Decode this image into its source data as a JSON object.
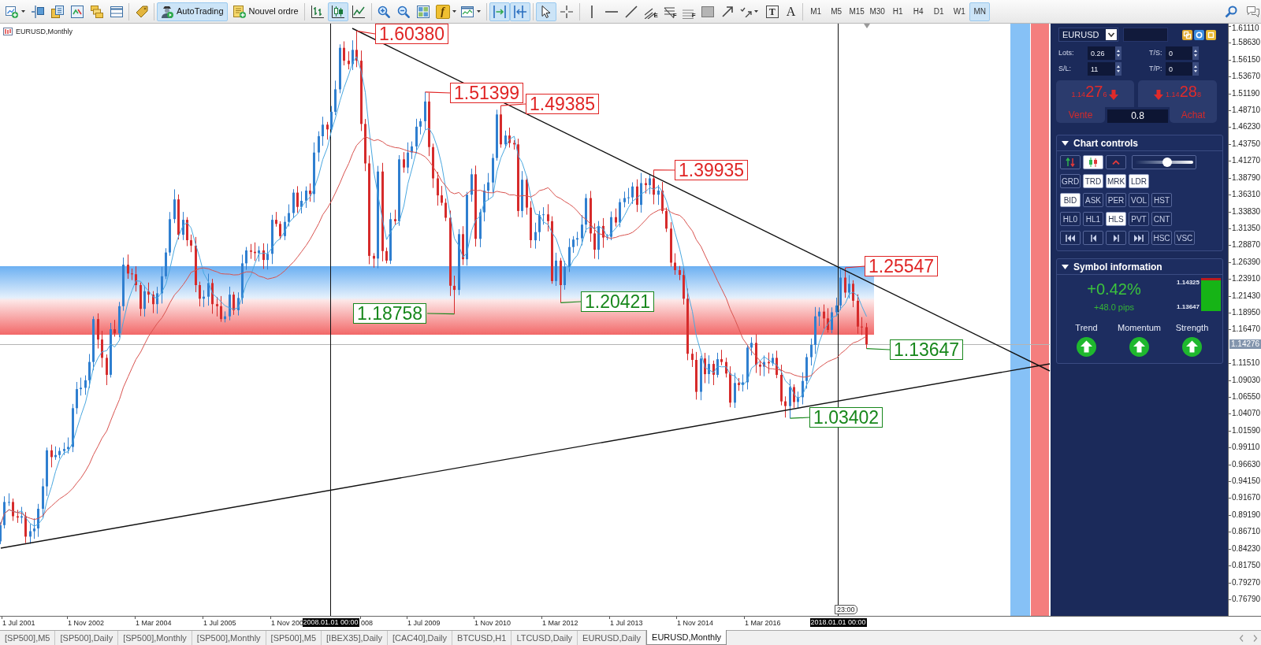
{
  "toolbar": {
    "auto_trading": {
      "label": "AutoTrading",
      "on": true
    },
    "new_order": {
      "label": "Nouvel ordre"
    },
    "chart_types": [
      {
        "selected": false
      },
      {
        "selected": true
      },
      {
        "selected": false
      }
    ],
    "indicators": {
      "label": "f"
    },
    "auto_scroll": {
      "on": true
    },
    "chart_shift": {
      "on": true
    },
    "cursor_modes": [
      {
        "selected": true
      },
      {
        "selected": false
      }
    ],
    "drawing_tools": [
      {
        "mark": "E"
      },
      {
        "mark": "F"
      },
      {
        "mark": "F"
      }
    ],
    "text_tools": [
      "T",
      "A"
    ],
    "timeframes": [
      {
        "label": "M1",
        "selected": false
      },
      {
        "label": "M5",
        "selected": false
      },
      {
        "label": "M15",
        "selected": false
      },
      {
        "label": "M30",
        "selected": false
      },
      {
        "label": "H1",
        "selected": false
      },
      {
        "label": "H4",
        "selected": false
      },
      {
        "label": "D1",
        "selected": false
      },
      {
        "label": "W1",
        "selected": false
      },
      {
        "label": "MN",
        "selected": true
      }
    ]
  },
  "chart": {
    "title": "EURUSD,Monthly",
    "price_labels": [
      {
        "text": "1.60380",
        "color": "#e02424"
      },
      {
        "text": "1.51399",
        "color": "#e02424"
      },
      {
        "text": "1.49385",
        "color": "#e02424"
      },
      {
        "text": "1.39935",
        "color": "#e02424"
      },
      {
        "text": "1.25547",
        "color": "#e02424"
      },
      {
        "text": "1.18758",
        "color": "#17871b"
      },
      {
        "text": "1.20421",
        "color": "#17871b"
      },
      {
        "text": "1.13647",
        "color": "#17871b"
      },
      {
        "text": "1.03402",
        "color": "#17871b"
      }
    ],
    "time_marker": "23:00"
  },
  "trade_panel": {
    "symbol": "EURUSD",
    "fields": [
      {
        "label": "Lots:",
        "value": "0.26"
      },
      {
        "label": "T/S:",
        "value": "0"
      },
      {
        "label": "S/L:",
        "value": "11"
      },
      {
        "label": "T/P:",
        "value": "0"
      }
    ],
    "sell": {
      "big_figure": "1.14",
      "pips": "27",
      "point": "6",
      "rising": false,
      "label": "Vente"
    },
    "buy": {
      "big_figure": "1.14",
      "pips": "28",
      "point": "8",
      "rising": false,
      "label": "Achat"
    },
    "spread": "0.8"
  },
  "chart_controls": {
    "title": "Chart controls",
    "expanded": true,
    "tool_buttons": [
      {
        "selected": false
      },
      {
        "selected": true
      },
      {
        "selected": false
      }
    ],
    "slider": {
      "level": 0.56
    },
    "toggle_rows": [
      [
        {
          "label": "GRD",
          "selected": false
        },
        {
          "label": "TRD",
          "selected": true
        },
        {
          "label": "MRK",
          "selected": true
        },
        {
          "label": "LDR",
          "selected": true
        }
      ],
      [
        {
          "label": "BID",
          "selected": true
        },
        {
          "label": "ASK",
          "selected": false
        },
        {
          "label": "PER",
          "selected": false
        },
        {
          "label": "VOL",
          "selected": false
        },
        {
          "label": "HST",
          "selected": false
        }
      ],
      [
        {
          "label": "HL0",
          "selected": false
        },
        {
          "label": "HL1",
          "selected": false
        },
        {
          "label": "HLS",
          "selected": true
        },
        {
          "label": "PVT",
          "selected": false
        },
        {
          "label": "CNT",
          "selected": false
        }
      ]
    ],
    "navigation": [
      {
        "kind": "icon",
        "selected": false
      },
      {
        "kind": "icon",
        "selected": false
      },
      {
        "kind": "icon",
        "selected": false
      },
      {
        "kind": "icon",
        "selected": false
      },
      {
        "kind": "text",
        "label": "HSC",
        "selected": false
      },
      {
        "kind": "text",
        "label": "VSC",
        "selected": false
      }
    ]
  },
  "symbol_information": {
    "title": "Symbol information",
    "expanded": true,
    "change_percent": "+0.42%",
    "change_pips": "+48.0 pips",
    "range_high": "1.14325",
    "range_low": "1.13647",
    "range_bar": {
      "level": 0.93
    },
    "signals": [
      {
        "label": "Trend",
        "rising": true
      },
      {
        "label": "Momentum",
        "rising": true
      },
      {
        "label": "Strength",
        "rising": true
      }
    ]
  },
  "price_axis": {
    "labels": [
      "1.61110",
      "1.58630",
      "1.56150",
      "1.53670",
      "1.51190",
      "1.48710",
      "1.46230",
      "1.43750",
      "1.41270",
      "1.38790",
      "1.36310",
      "1.33830",
      "1.31350",
      "1.28870",
      "1.26390",
      "1.23910",
      "1.21430",
      "1.18950",
      "1.16470",
      "1.11510",
      "1.09030",
      "1.06550",
      "1.04070",
      "1.01590",
      "0.99110",
      "0.96630",
      "0.94150",
      "0.91670",
      "0.89190",
      "0.86710",
      "0.84230",
      "0.81750",
      "0.79270",
      "0.76790"
    ],
    "current_price": "1.14276"
  },
  "time_axis": {
    "labels": [
      {
        "text": "1 Jul 2001",
        "kind": "date"
      },
      {
        "text": "1 Nov 2002",
        "kind": "date"
      },
      {
        "text": "1 Mar 2004",
        "kind": "date"
      },
      {
        "text": "1 Jul 2005",
        "kind": "date"
      },
      {
        "text": "1 Nov 200",
        "kind": "date"
      },
      {
        "text": "2008.01.01 00:00",
        "kind": "cursor"
      },
      {
        "text": "008",
        "kind": "date"
      },
      {
        "text": "1 Jul 2009",
        "kind": "date"
      },
      {
        "text": "1 Nov 2010",
        "kind": "date"
      },
      {
        "text": "1 Mar 2012",
        "kind": "date"
      },
      {
        "text": "1 Jul 2013",
        "kind": "date"
      },
      {
        "text": "1 Nov 2014",
        "kind": "date"
      },
      {
        "text": "1 Mar 2016",
        "kind": "date"
      },
      {
        "text": "2018.01.01 00:00",
        "kind": "cursor"
      }
    ]
  },
  "tabs": [
    {
      "label": "[SP500],M5",
      "selected": false
    },
    {
      "label": "[SP500],Daily",
      "selected": false
    },
    {
      "label": "[SP500],Monthly",
      "selected": false
    },
    {
      "label": "[SP500],Monthly",
      "selected": false
    },
    {
      "label": "[SP500],M5",
      "selected": false
    },
    {
      "label": "[IBEX35],Daily",
      "selected": false
    },
    {
      "label": "[CAC40],Daily",
      "selected": false
    },
    {
      "label": "BTCUSD,H1",
      "selected": false
    },
    {
      "label": "LTCUSD,Daily",
      "selected": false
    },
    {
      "label": "EURUSD,Daily",
      "selected": false
    },
    {
      "label": "EURUSD,Monthly",
      "selected": true
    }
  ]
}
